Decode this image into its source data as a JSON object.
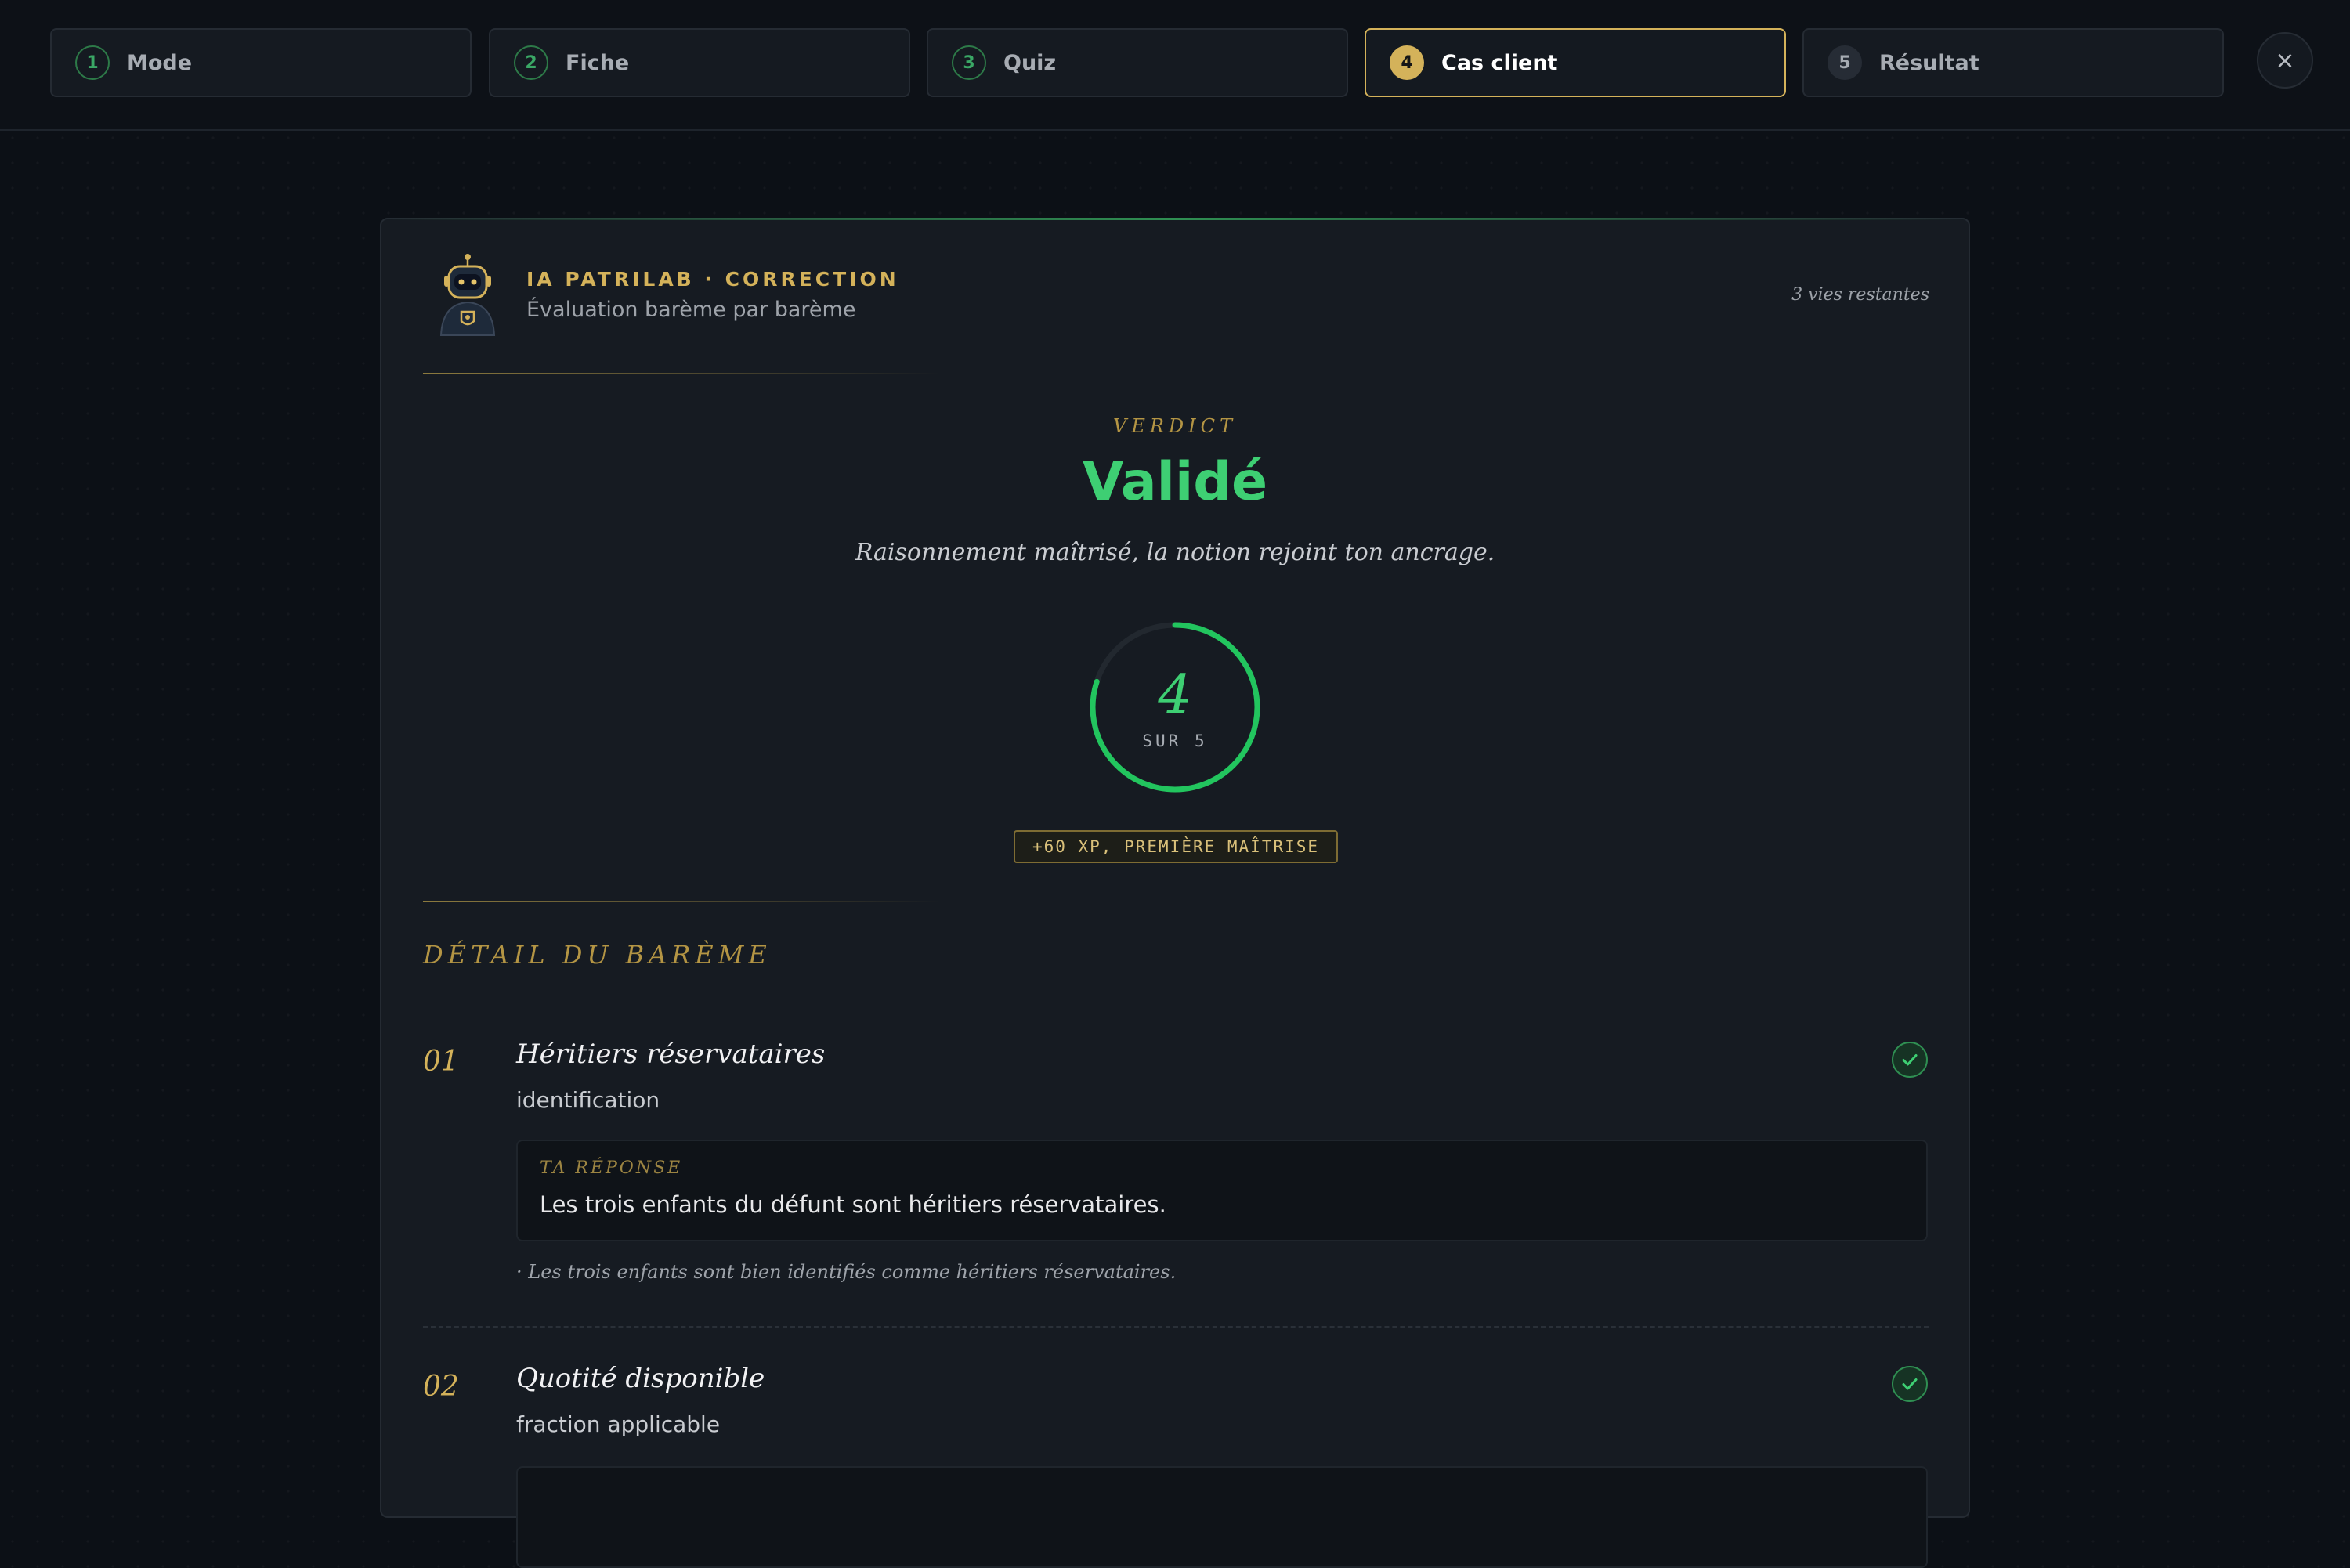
{
  "steps": [
    {
      "num": "1",
      "label": "Mode",
      "state": "done"
    },
    {
      "num": "2",
      "label": "Fiche",
      "state": "done"
    },
    {
      "num": "3",
      "label": "Quiz",
      "state": "done"
    },
    {
      "num": "4",
      "label": "Cas client",
      "state": "active"
    },
    {
      "num": "5",
      "label": "Résultat",
      "state": "pending"
    }
  ],
  "close_label": "×",
  "header": {
    "title": "IA PATRILAB · CORRECTION",
    "subtitle": "Évaluation barème par barème",
    "lives": "3 vies restantes"
  },
  "verdict": {
    "label": "VERDICT",
    "value": "Validé",
    "text": "Raisonnement maîtrisé, la notion rejoint ton ancrage."
  },
  "score": {
    "value": "4",
    "max_label": "SUR 5",
    "fraction": 0.8
  },
  "xp_badge": "+60 XP, PREMIÈRE MAÎTRISE",
  "section_title": "DÉTAIL DU BARÈME",
  "criteria": [
    {
      "num": "01",
      "title": "Héritiers réservataires",
      "subtitle": "identification",
      "answer_label": "TA RÉPONSE",
      "answer": "Les trois enfants du défunt sont héritiers réservataires.",
      "feedback": "· Les trois enfants sont bien identifiés comme héritiers réservataires.",
      "status": "ok"
    },
    {
      "num": "02",
      "title": "Quotité disponible",
      "subtitle": "fraction applicable",
      "status": "ok"
    }
  ],
  "colors": {
    "accent_gold": "#d4b25a",
    "success_green": "#3ecf73",
    "background": "#0c1016",
    "card": "#161b22"
  }
}
